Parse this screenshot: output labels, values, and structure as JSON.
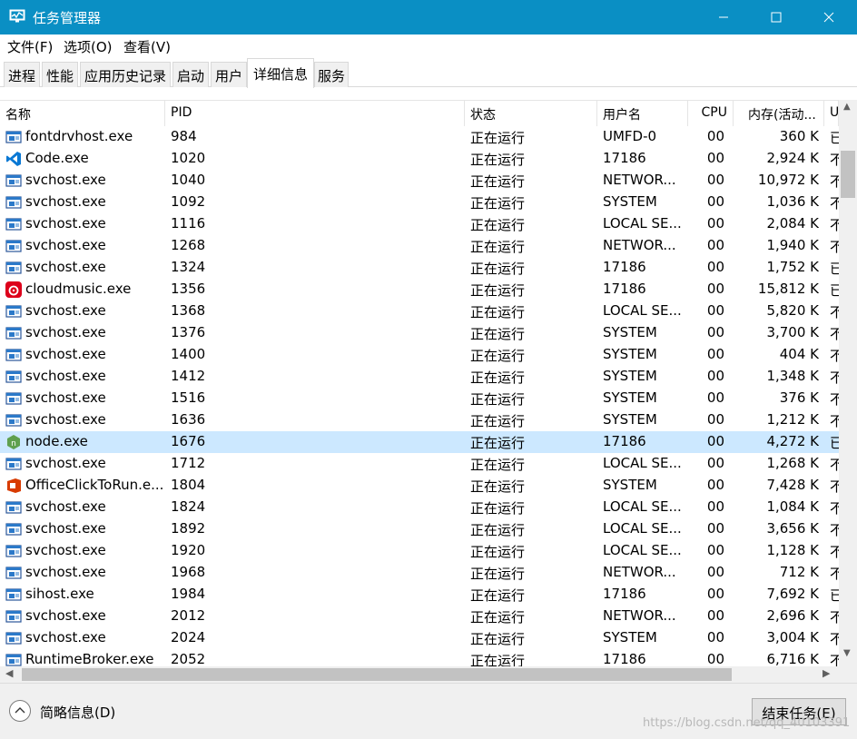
{
  "window": {
    "title": "任务管理器",
    "minimize_glyph": "—",
    "maximize_glyph": "☐",
    "close_glyph": "✕",
    "accent": "#0a8fc4"
  },
  "menu": [
    "文件(F)",
    "选项(O)",
    "查看(V)"
  ],
  "tabs": [
    "进程",
    "性能",
    "应用历史记录",
    "启动",
    "用户",
    "详细信息",
    "服务"
  ],
  "active_tab": "详细信息",
  "columns": {
    "name": "名称",
    "pid": "PID",
    "status": "状态",
    "user": "用户名",
    "cpu": "CPU",
    "memory": "内存(活动...",
    "desc": "U"
  },
  "sort_arrow": "^",
  "rows": [
    {
      "icon": "service-exe-icon",
      "name": "fontdrvhost.exe",
      "pid": "984",
      "status": "正在运行",
      "user": "UMFD-0",
      "cpu": "00",
      "mem": "360 K",
      "desc": "已"
    },
    {
      "icon": "vscode-icon",
      "name": "Code.exe",
      "pid": "1020",
      "status": "正在运行",
      "user": "17186",
      "cpu": "00",
      "mem": "2,924 K",
      "desc": "不"
    },
    {
      "icon": "service-exe-icon",
      "name": "svchost.exe",
      "pid": "1040",
      "status": "正在运行",
      "user": "NETWOR...",
      "cpu": "00",
      "mem": "10,972 K",
      "desc": "不"
    },
    {
      "icon": "service-exe-icon",
      "name": "svchost.exe",
      "pid": "1092",
      "status": "正在运行",
      "user": "SYSTEM",
      "cpu": "00",
      "mem": "1,036 K",
      "desc": "不"
    },
    {
      "icon": "service-exe-icon",
      "name": "svchost.exe",
      "pid": "1116",
      "status": "正在运行",
      "user": "LOCAL SE...",
      "cpu": "00",
      "mem": "2,084 K",
      "desc": "不"
    },
    {
      "icon": "service-exe-icon",
      "name": "svchost.exe",
      "pid": "1268",
      "status": "正在运行",
      "user": "NETWOR...",
      "cpu": "00",
      "mem": "1,940 K",
      "desc": "不"
    },
    {
      "icon": "service-exe-icon",
      "name": "svchost.exe",
      "pid": "1324",
      "status": "正在运行",
      "user": "17186",
      "cpu": "00",
      "mem": "1,752 K",
      "desc": "已"
    },
    {
      "icon": "cloudmusic-icon",
      "name": "cloudmusic.exe",
      "pid": "1356",
      "status": "正在运行",
      "user": "17186",
      "cpu": "00",
      "mem": "15,812 K",
      "desc": "已"
    },
    {
      "icon": "service-exe-icon",
      "name": "svchost.exe",
      "pid": "1368",
      "status": "正在运行",
      "user": "LOCAL SE...",
      "cpu": "00",
      "mem": "5,820 K",
      "desc": "不"
    },
    {
      "icon": "service-exe-icon",
      "name": "svchost.exe",
      "pid": "1376",
      "status": "正在运行",
      "user": "SYSTEM",
      "cpu": "00",
      "mem": "3,700 K",
      "desc": "不"
    },
    {
      "icon": "service-exe-icon",
      "name": "svchost.exe",
      "pid": "1400",
      "status": "正在运行",
      "user": "SYSTEM",
      "cpu": "00",
      "mem": "404 K",
      "desc": "不"
    },
    {
      "icon": "service-exe-icon",
      "name": "svchost.exe",
      "pid": "1412",
      "status": "正在运行",
      "user": "SYSTEM",
      "cpu": "00",
      "mem": "1,348 K",
      "desc": "不"
    },
    {
      "icon": "service-exe-icon",
      "name": "svchost.exe",
      "pid": "1516",
      "status": "正在运行",
      "user": "SYSTEM",
      "cpu": "00",
      "mem": "376 K",
      "desc": "不"
    },
    {
      "icon": "service-exe-icon",
      "name": "svchost.exe",
      "pid": "1636",
      "status": "正在运行",
      "user": "SYSTEM",
      "cpu": "00",
      "mem": "1,212 K",
      "desc": "不"
    },
    {
      "icon": "nodejs-icon",
      "name": "node.exe",
      "pid": "1676",
      "status": "正在运行",
      "user": "17186",
      "cpu": "00",
      "mem": "4,272 K",
      "desc": "已",
      "selected": true
    },
    {
      "icon": "service-exe-icon",
      "name": "svchost.exe",
      "pid": "1712",
      "status": "正在运行",
      "user": "LOCAL SE...",
      "cpu": "00",
      "mem": "1,268 K",
      "desc": "不"
    },
    {
      "icon": "office-icon",
      "name": "OfficeClickToRun.e...",
      "pid": "1804",
      "status": "正在运行",
      "user": "SYSTEM",
      "cpu": "00",
      "mem": "7,428 K",
      "desc": "不"
    },
    {
      "icon": "service-exe-icon",
      "name": "svchost.exe",
      "pid": "1824",
      "status": "正在运行",
      "user": "LOCAL SE...",
      "cpu": "00",
      "mem": "1,084 K",
      "desc": "不"
    },
    {
      "icon": "service-exe-icon",
      "name": "svchost.exe",
      "pid": "1892",
      "status": "正在运行",
      "user": "LOCAL SE...",
      "cpu": "00",
      "mem": "3,656 K",
      "desc": "不"
    },
    {
      "icon": "service-exe-icon",
      "name": "svchost.exe",
      "pid": "1920",
      "status": "正在运行",
      "user": "LOCAL SE...",
      "cpu": "00",
      "mem": "1,128 K",
      "desc": "不"
    },
    {
      "icon": "service-exe-icon",
      "name": "svchost.exe",
      "pid": "1968",
      "status": "正在运行",
      "user": "NETWOR...",
      "cpu": "00",
      "mem": "712 K",
      "desc": "不"
    },
    {
      "icon": "service-exe-icon",
      "name": "sihost.exe",
      "pid": "1984",
      "status": "正在运行",
      "user": "17186",
      "cpu": "00",
      "mem": "7,692 K",
      "desc": "已"
    },
    {
      "icon": "service-exe-icon",
      "name": "svchost.exe",
      "pid": "2012",
      "status": "正在运行",
      "user": "NETWOR...",
      "cpu": "00",
      "mem": "2,696 K",
      "desc": "不"
    },
    {
      "icon": "service-exe-icon",
      "name": "svchost.exe",
      "pid": "2024",
      "status": "正在运行",
      "user": "SYSTEM",
      "cpu": "00",
      "mem": "3,004 K",
      "desc": "不"
    },
    {
      "icon": "service-exe-icon",
      "name": "RuntimeBroker.exe",
      "pid": "2052",
      "status": "正在运行",
      "user": "17186",
      "cpu": "00",
      "mem": "6,716 K",
      "desc": "不"
    }
  ],
  "footer": {
    "fewer_details": "简略信息(D)",
    "end_task": "结束任务(E)",
    "watermark": "https://blog.csdn.net/qq_40103391"
  },
  "selection_color": "#cce8ff"
}
